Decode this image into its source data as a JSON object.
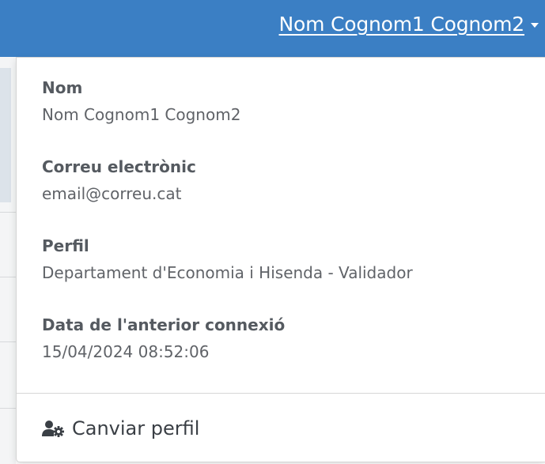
{
  "header": {
    "user_name": "Nom Cognom1 Cognom2"
  },
  "dropdown": {
    "fields": [
      {
        "label": "Nom",
        "value": "Nom Cognom1 Cognom2"
      },
      {
        "label": "Correu electrònic",
        "value": "email@correu.cat"
      },
      {
        "label": "Perfil",
        "value": "Departament d'Economia i Hisenda - Validador"
      },
      {
        "label": "Data de l'anterior connexió",
        "value": "15/04/2024 08:52:06"
      }
    ],
    "change_profile": {
      "label": "Canviar perfil",
      "icon": "user-cog-icon"
    }
  },
  "colors": {
    "topbar": "#3b7fc4",
    "label": "#555a60",
    "value": "#606368"
  }
}
